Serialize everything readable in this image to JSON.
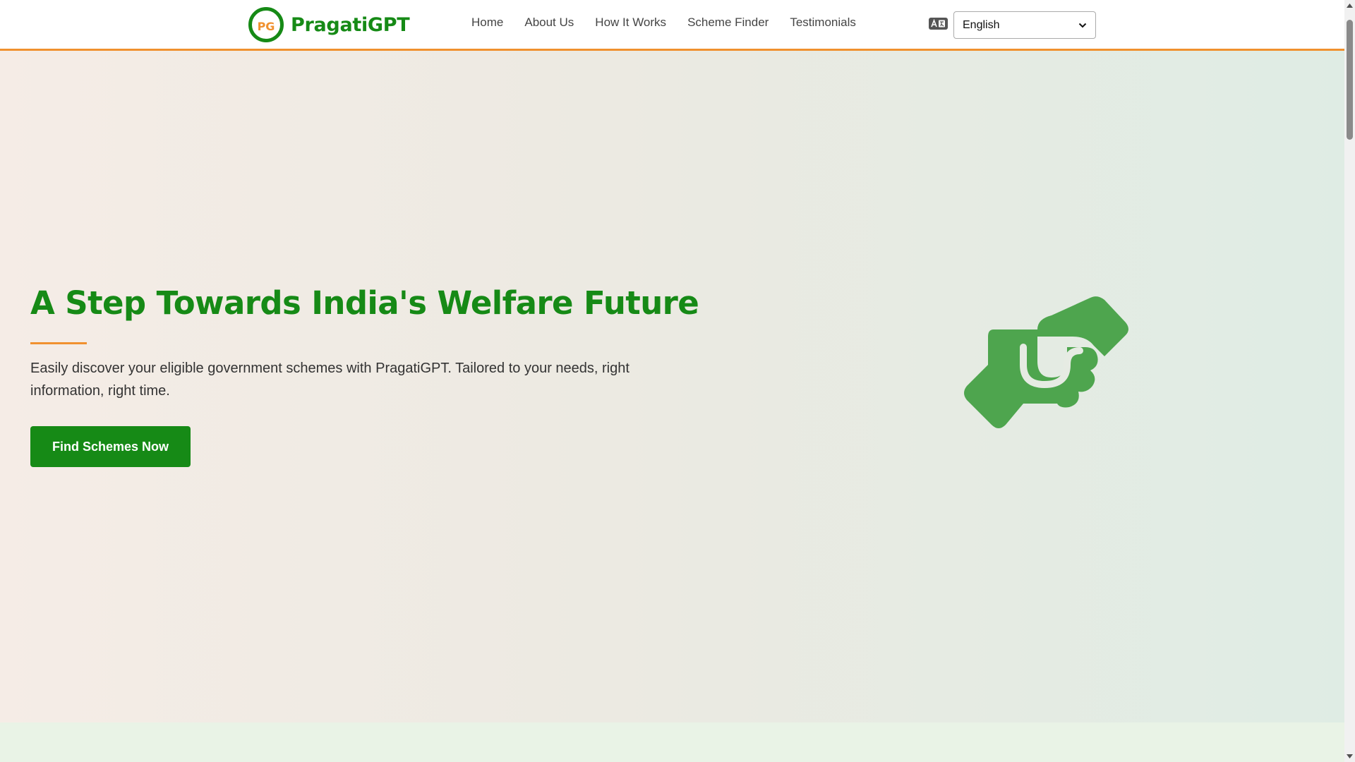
{
  "brand": {
    "logo_initials": "PG",
    "name": "PragatiGPT"
  },
  "nav": {
    "links": [
      {
        "label": "Home"
      },
      {
        "label": "About Us"
      },
      {
        "label": "How It Works"
      },
      {
        "label": "Scheme Finder"
      },
      {
        "label": "Testimonials"
      }
    ]
  },
  "language": {
    "icon": "language-icon",
    "selected": "English"
  },
  "hero": {
    "title": "A Step Towards India's Welfare Future",
    "description": "Easily discover your eligible government schemes with PragatiGPT. Tailored to your needs, right information, right time.",
    "cta_label": "Find Schemes Now",
    "illustration_icon": "handshake-icon"
  },
  "colors": {
    "brand_green": "#168a16",
    "accent_orange": "#f0912f",
    "icon_green": "#4ea54e"
  }
}
